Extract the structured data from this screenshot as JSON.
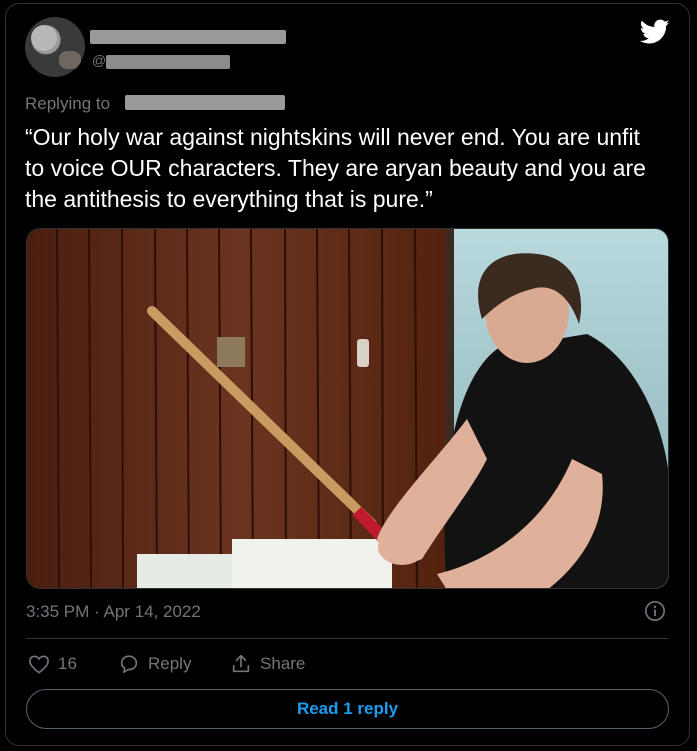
{
  "tweet": {
    "author": {
      "display_name": "",
      "handle_prefix": "@",
      "handle": ""
    },
    "replying_to_label": "Replying to",
    "text": "“Our holy war against nightskins will never end. You are unfit to voice OUR characters. They are aryan beauty and you are the antithesis to everything that is pure.”",
    "timestamp": "3:35 PM · Apr 14, 2022",
    "likes": "16",
    "reply_label": "Reply",
    "share_label": "Share",
    "read_replies_label": "Read 1 reply"
  },
  "icons": {
    "brand": "twitter-bird-icon",
    "info": "info-icon",
    "like": "heart-icon",
    "reply": "reply-bubble-icon",
    "share": "share-icon"
  },
  "colors": {
    "background": "#000000",
    "text": "#ffffff",
    "muted": "#71767b",
    "accent": "#1d9bf0",
    "border": "#2f3336"
  }
}
